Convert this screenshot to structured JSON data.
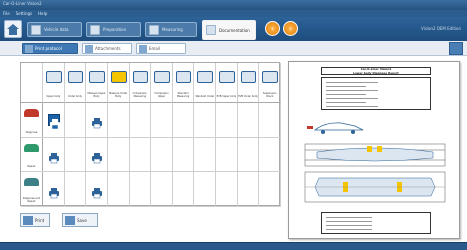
{
  "window": {
    "title": "Car-O-Liner Vision2"
  },
  "menu": [
    "File",
    "Settings",
    "Help"
  ],
  "tabs": [
    {
      "label": "Vehicle data",
      "active": false
    },
    {
      "label": "Preparation",
      "active": false
    },
    {
      "label": "Measuring",
      "active": false
    },
    {
      "label": "Documentation",
      "active": true
    }
  ],
  "version": "Vision2 OEM Edition",
  "subtoolbar": {
    "print_label": "Print protocol",
    "attach_label": "Attachments",
    "email_label": "Email"
  },
  "grid": {
    "columns": [
      "Upper body",
      "Under body",
      "Measure Upper Body",
      "Measure Under Body",
      "Comparison Measuring",
      "Comparison Upper",
      "Standard Measuring",
      "Standard Under",
      "EVB Upper body",
      "EVB Under body",
      "Suspension Check"
    ],
    "rows": [
      {
        "label": "Diagnose",
        "car_color": "#c0392b",
        "cells": [
          "selected",
          "",
          "printer",
          "",
          "",
          "",
          "",
          "",
          "",
          "",
          ""
        ]
      },
      {
        "label": "Repair",
        "car_color": "#2e9a6b",
        "cells": [
          "printer",
          "",
          "printer",
          "",
          "",
          "",
          "",
          "",
          "",
          "",
          ""
        ]
      },
      {
        "label": "Diagnose and Repair",
        "car_color": "#3c7f86",
        "cells": [
          "printer",
          "",
          "printer",
          "",
          "",
          "",
          "",
          "",
          "",
          "",
          ""
        ]
      }
    ]
  },
  "bottom": {
    "print_label": "Print",
    "save_label": "Save"
  },
  "document": {
    "title": "Car-O-Liner Vision2",
    "subtitle": "Lower body Diagnose Report"
  },
  "colors": {
    "accent": "#2d6399",
    "highlight": "#f5c400"
  }
}
